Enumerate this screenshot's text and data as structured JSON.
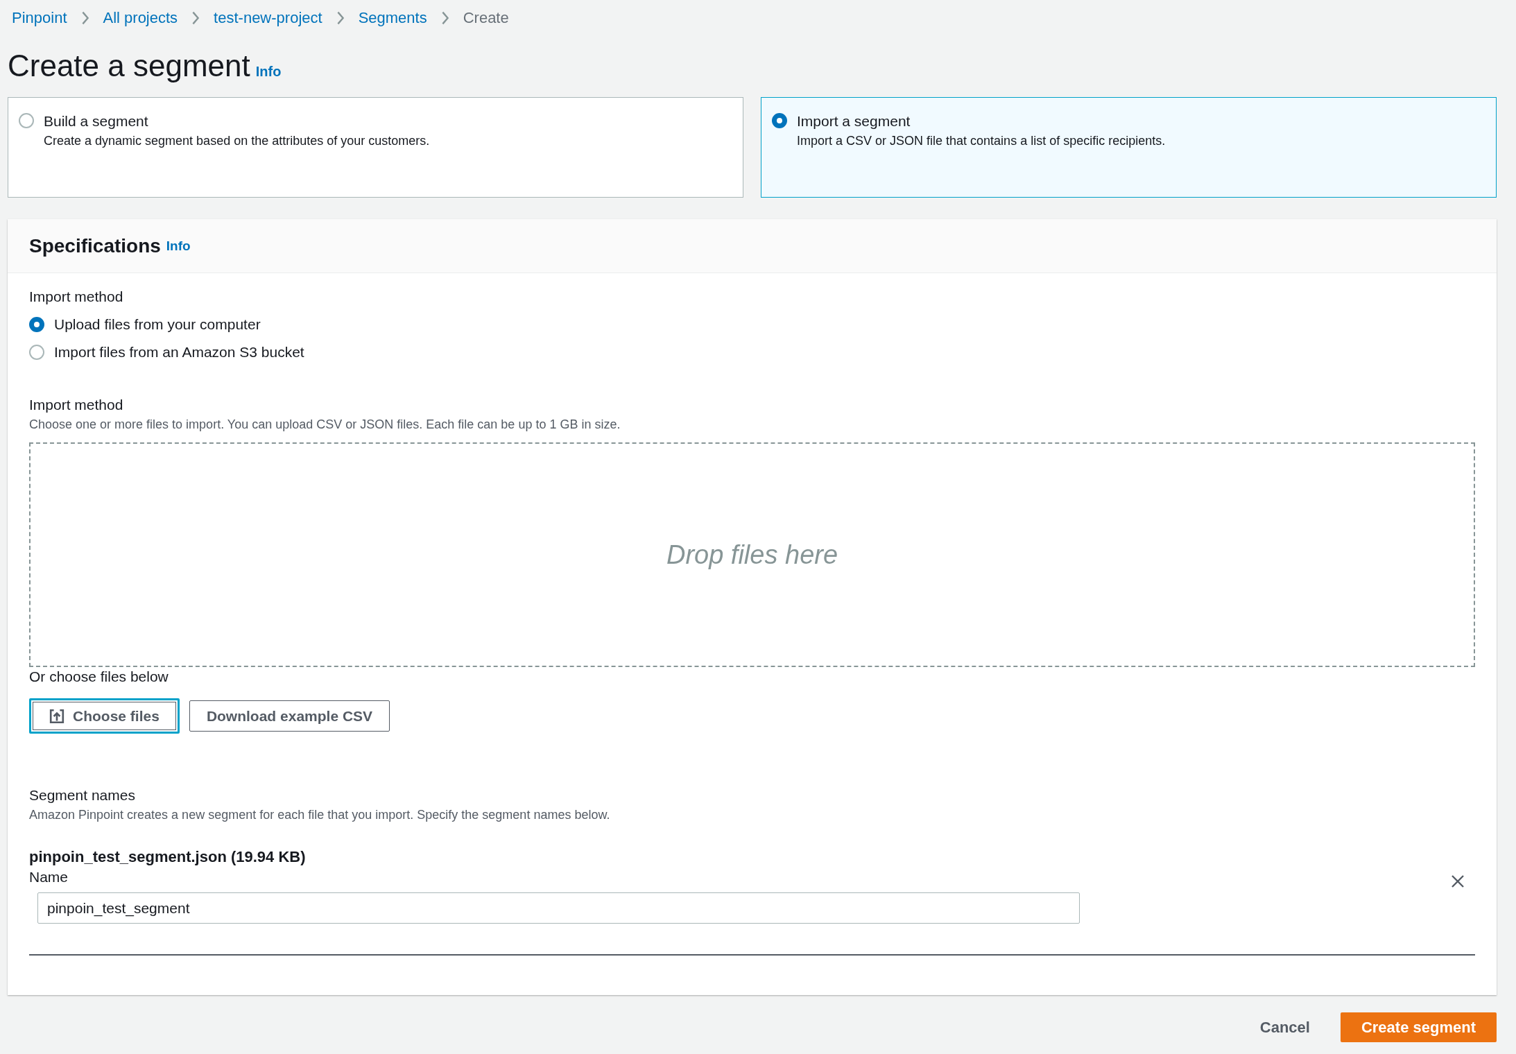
{
  "breadcrumb": [
    {
      "label": "Pinpoint",
      "kind": "link"
    },
    {
      "label": "All projects",
      "kind": "link"
    },
    {
      "label": "test-new-project",
      "kind": "link"
    },
    {
      "label": "Segments",
      "kind": "link"
    },
    {
      "label": "Create",
      "kind": "current"
    }
  ],
  "page_title": "Create a segment",
  "title_info": "Info",
  "segment_types": [
    {
      "title": "Build a segment",
      "description": "Create a dynamic segment based on the attributes of your customers.",
      "selected": false
    },
    {
      "title": "Import a segment",
      "description": "Import a CSV or JSON file that contains a list of specific recipients.",
      "selected": true
    }
  ],
  "specifications": {
    "title": "Specifications",
    "info": "Info",
    "import_method": {
      "label": "Import method",
      "options": [
        {
          "label": "Upload files from your computer",
          "selected": true
        },
        {
          "label": "Import files from an Amazon S3 bucket",
          "selected": false
        }
      ]
    },
    "files": {
      "label": "Import method",
      "description": "Choose one or more files to import. You can upload CSV or JSON files. Each file can be up to 1 GB in size.",
      "drop_zone": "Drop files here",
      "or_label": "Or choose files below",
      "buttons": [
        {
          "label": "Choose files",
          "kind": "upload",
          "focused": true
        },
        {
          "label": "Download example CSV",
          "kind": "plain",
          "focused": false
        }
      ]
    },
    "segment_names": {
      "label": "Segment names",
      "description": "Amazon Pinpoint creates a new segment for each file that you import. Specify the segment names below.",
      "entries": [
        {
          "file": "pinpoin_test_segment.json (19.94 KB)",
          "name_label": "Name",
          "value": "pinpoin_test_segment"
        }
      ]
    }
  },
  "footer": {
    "cancel": "Cancel",
    "submit": "Create segment"
  }
}
